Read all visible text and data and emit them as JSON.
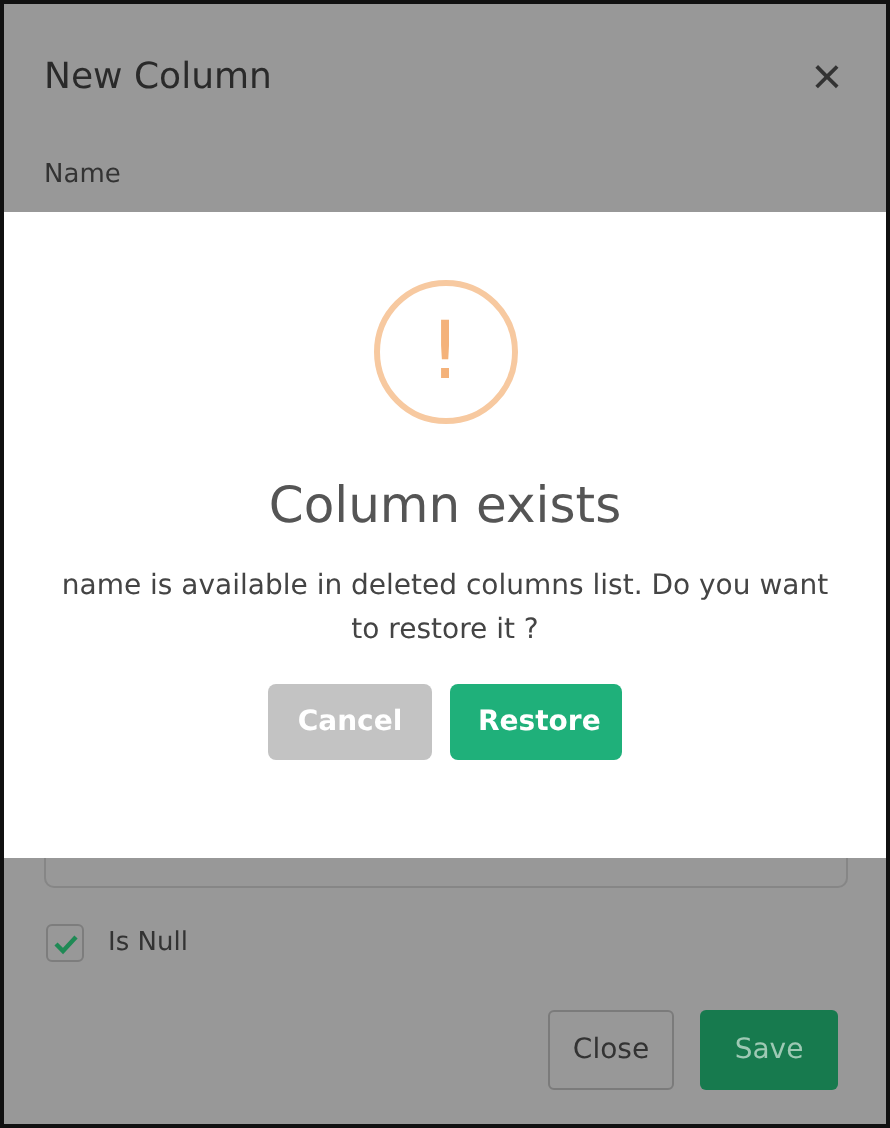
{
  "dialog": {
    "title": "New Column",
    "close_icon": "×",
    "name_label": "Name",
    "is_null": {
      "label": "Is Null",
      "checked": true
    },
    "buttons": [
      {
        "label": "Close",
        "kind": "secondary"
      },
      {
        "label": "Save",
        "kind": "primary"
      }
    ]
  },
  "alert": {
    "icon": "!",
    "title": "Column exists",
    "message": "name is available in deleted columns list. Do you want to restore it ?",
    "buttons": [
      {
        "label": "Cancel",
        "kind": "cancel"
      },
      {
        "label": "Restore",
        "kind": "confirm"
      }
    ]
  }
}
